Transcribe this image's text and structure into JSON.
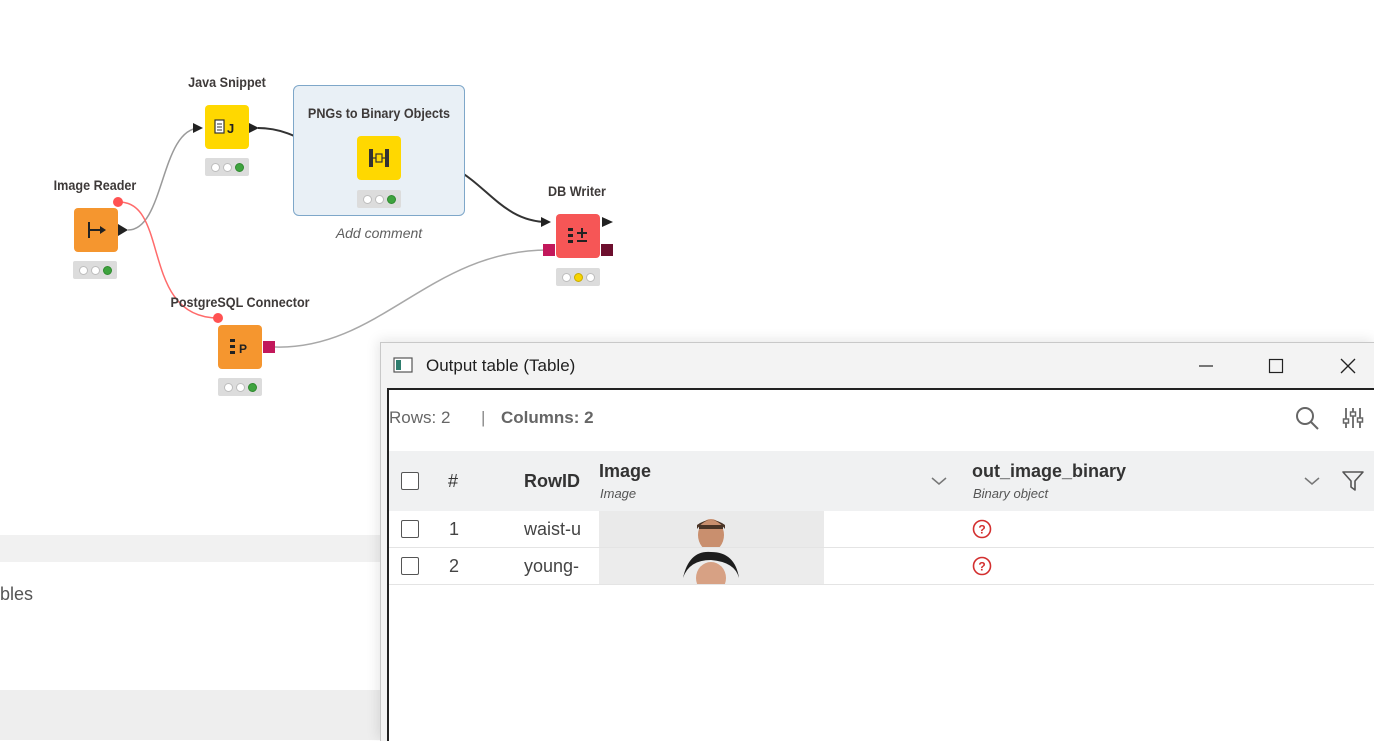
{
  "workflow": {
    "nodes": {
      "java_snippet": {
        "title": "Java Snippet",
        "glyph": "J"
      },
      "pngs_to_binary": {
        "title": "PNGs to Binary Objects"
      },
      "image_reader": {
        "title": "Image Reader"
      },
      "db_writer": {
        "title": "DB Writer"
      },
      "postgres_connector": {
        "title": "PostgreSQL Connector",
        "glyph": "P"
      }
    },
    "add_comment": "Add comment",
    "colors": {
      "orange": "#f5962f",
      "yellow": "#ffd800",
      "red": "#f65656",
      "db_port": "#c2185b"
    }
  },
  "background_panel": {
    "partial_label": "bles"
  },
  "output_window": {
    "title": "Output table (Table)",
    "info": {
      "rows_label": "Rows: 2",
      "separator": "|",
      "columns_label": "Columns: 2"
    },
    "columns": {
      "index": "#",
      "rowid": "RowID",
      "image": {
        "name": "Image",
        "type": "Image"
      },
      "binary": {
        "name": "out_image_binary",
        "type": "Binary object"
      }
    },
    "rows": [
      {
        "index": "1",
        "rowid": "waist-u"
      },
      {
        "index": "2",
        "rowid": "young-"
      }
    ]
  }
}
